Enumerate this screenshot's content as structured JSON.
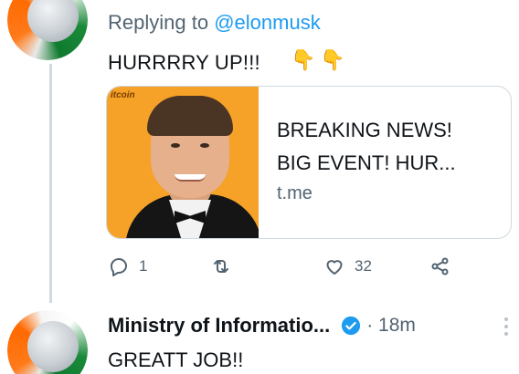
{
  "tweet1": {
    "replying_prefix": "Replying to",
    "replying_mention": "@elonmusk",
    "text": "HURRRRY UP!!!",
    "emoji": [
      "👇",
      "👇"
    ],
    "emoji_names": [
      "backhand-index-pointing-down-icon",
      "backhand-index-pointing-down-icon"
    ],
    "card": {
      "image_tag": "itcoin",
      "line1": "BREAKING NEWS!",
      "line2": "BIG EVENT! HUR...",
      "domain": "t.me"
    },
    "actions": {
      "reply_count": "1",
      "retweet_count": "",
      "like_count": "32"
    }
  },
  "tweet2": {
    "author_name": "Ministry of Informatio...",
    "time": "· 18m",
    "text": "GREATT JOB!!"
  },
  "colors": {
    "accent": "#1d9bf0",
    "secondary_text": "#536471",
    "border": "#cfd9de",
    "card_background": "#f6a228"
  }
}
